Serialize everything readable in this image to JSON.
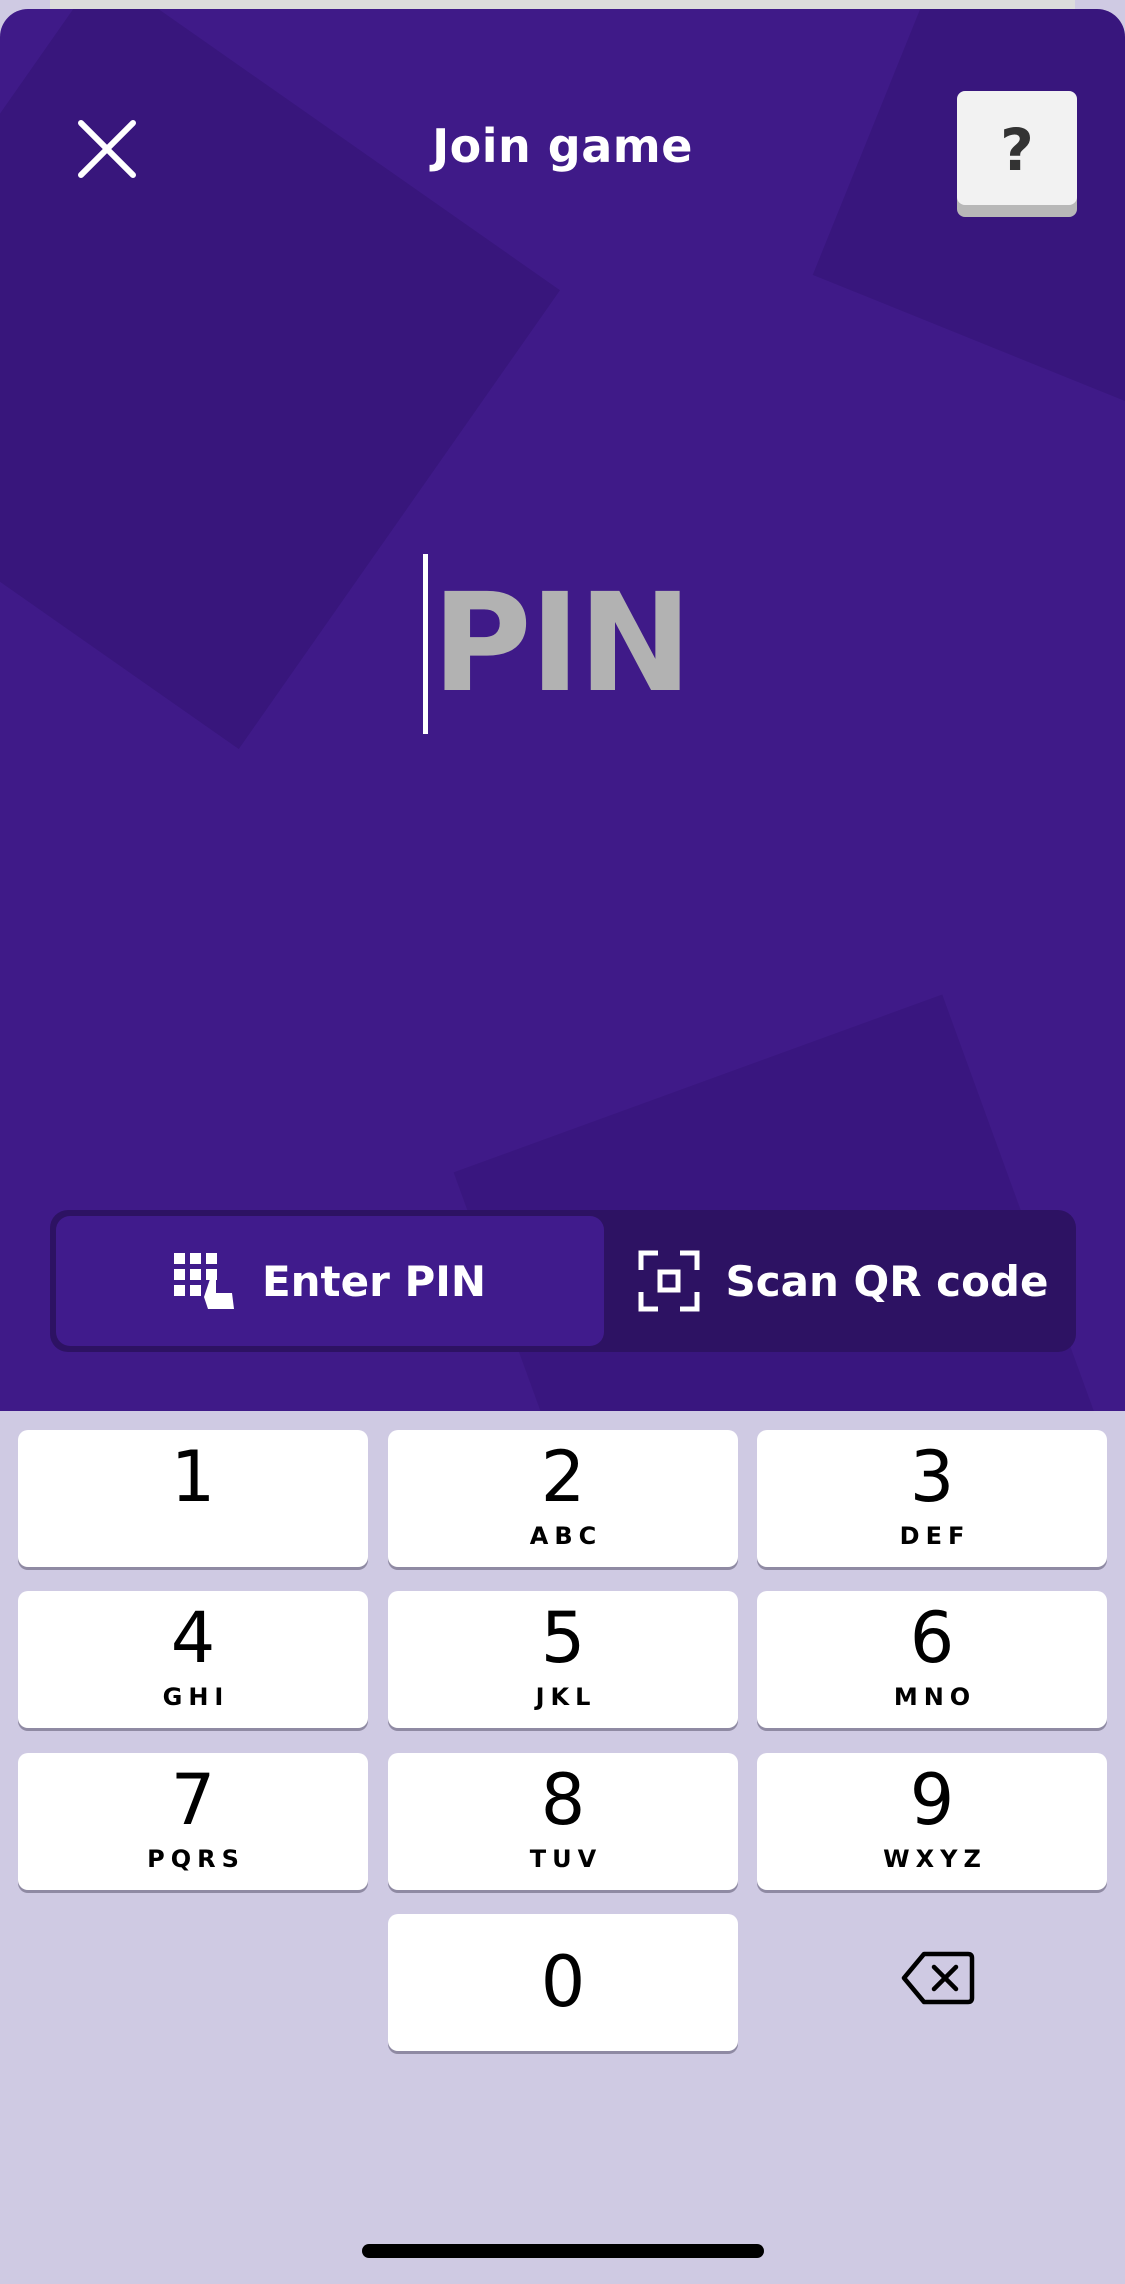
{
  "header": {
    "title": "Join game",
    "close_icon": "close-icon",
    "help_label": "?"
  },
  "pin": {
    "placeholder": "PIN",
    "value": ""
  },
  "mode_toggle": {
    "tabs": [
      {
        "label": "Enter PIN",
        "icon": "keypad-icon",
        "active": true
      },
      {
        "label": "Scan QR code",
        "icon": "qr-scan-icon",
        "active": false
      }
    ]
  },
  "keypad": {
    "keys": [
      {
        "digit": "1",
        "letters": ""
      },
      {
        "digit": "2",
        "letters": "ABC"
      },
      {
        "digit": "3",
        "letters": "DEF"
      },
      {
        "digit": "4",
        "letters": "GHI"
      },
      {
        "digit": "5",
        "letters": "JKL"
      },
      {
        "digit": "6",
        "letters": "MNO"
      },
      {
        "digit": "7",
        "letters": "PQRS"
      },
      {
        "digit": "8",
        "letters": "TUV"
      },
      {
        "digit": "9",
        "letters": "WXYZ"
      },
      {
        "digit": "0",
        "letters": ""
      }
    ],
    "backspace_icon": "backspace-icon"
  },
  "colors": {
    "sheet_background": "#3f1a88",
    "toggle_track": "#2d1263",
    "keypad_background": "#cfcae3",
    "placeholder_text": "#b2b2b2"
  }
}
